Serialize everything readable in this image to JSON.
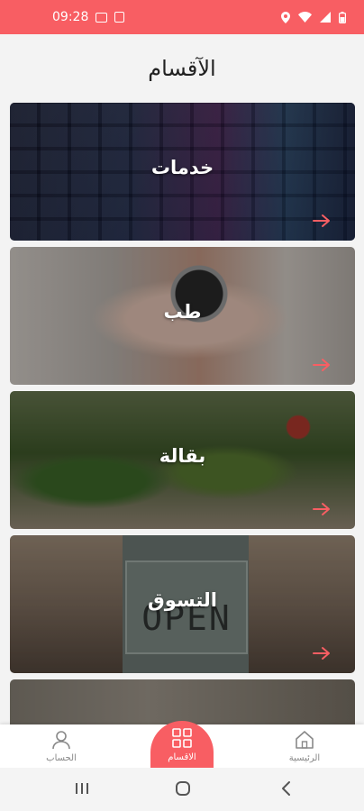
{
  "status_bar": {
    "time": "09:28",
    "background_color": "#f85e63",
    "icons": [
      "gallery-icon",
      "notification-icon",
      "location-icon",
      "wifi-icon",
      "signal-icon",
      "battery-icon"
    ]
  },
  "page": {
    "title": "الآقسام"
  },
  "categories": [
    {
      "label": "خدمات",
      "image": "keyboard-neon-image",
      "arrow": "arrow-right-icon"
    },
    {
      "label": "طب",
      "image": "stethoscope-hand-image",
      "arrow": "arrow-right-icon"
    },
    {
      "label": "بقالة",
      "image": "vegetables-market-image",
      "arrow": "arrow-right-icon"
    },
    {
      "label": "التسوق",
      "image": "open-sign-image",
      "sign_text": "OPEN",
      "arrow": "arrow-right-icon"
    },
    {
      "label": "",
      "image": "restaurant-image"
    }
  ],
  "bottom_nav": {
    "account_label": "الحساب",
    "categories_label": "الاقسام",
    "home_label": "الرئيسية",
    "active": "categories",
    "accent_color": "#f85e63"
  },
  "system_nav": [
    "recent-apps-icon",
    "home-circle-icon",
    "back-chevron-icon"
  ]
}
